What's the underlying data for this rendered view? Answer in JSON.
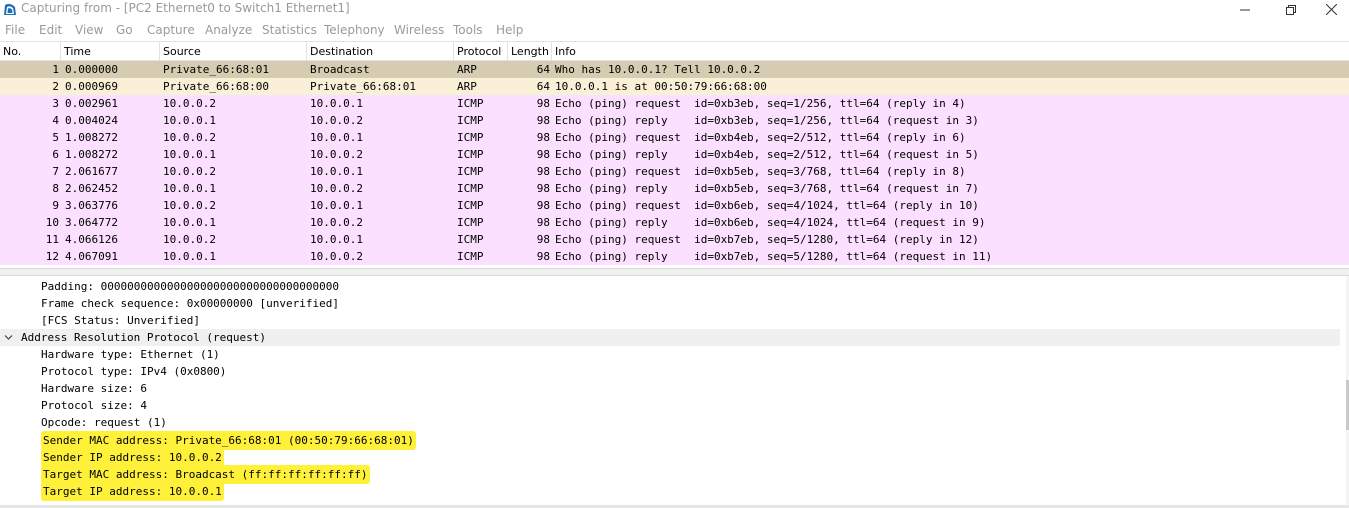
{
  "window": {
    "title": "Capturing from - [PC2 Ethernet0 to Switch1 Ethernet1]",
    "app_icon": "wireshark-fin-icon",
    "controls": [
      "minimize-icon",
      "restore-icon",
      "close-icon"
    ]
  },
  "menu": [
    "File",
    "Edit",
    "View",
    "Go",
    "Capture",
    "Analyze",
    "Statistics",
    "Telephony",
    "Wireless",
    "Tools",
    "Help"
  ],
  "packet_list": {
    "columns": [
      "No.",
      "Time",
      "Source",
      "Destination",
      "Protocol",
      "Length",
      "Info"
    ],
    "rows": [
      {
        "no": "1",
        "time": "0.000000",
        "source": "Private_66:68:01",
        "destination": "Broadcast",
        "protocol": "ARP",
        "length": "64",
        "info": "Who has 10.0.0.1? Tell 10.0.0.2",
        "color": "#d6ccb1"
      },
      {
        "no": "2",
        "time": "0.000969",
        "source": "Private_66:68:00",
        "destination": "Private_66:68:01",
        "protocol": "ARP",
        "length": "64",
        "info": "10.0.0.1 is at 00:50:79:66:68:00",
        "color": "#faf0d7"
      },
      {
        "no": "3",
        "time": "0.002961",
        "source": "10.0.0.2",
        "destination": "10.0.0.1",
        "protocol": "ICMP",
        "length": "98",
        "info": "Echo (ping) request  id=0xb3eb, seq=1/256, ttl=64 (reply in 4)",
        "color": "#fce0ff"
      },
      {
        "no": "4",
        "time": "0.004024",
        "source": "10.0.0.1",
        "destination": "10.0.0.2",
        "protocol": "ICMP",
        "length": "98",
        "info": "Echo (ping) reply    id=0xb3eb, seq=1/256, ttl=64 (request in 3)",
        "color": "#fce0ff"
      },
      {
        "no": "5",
        "time": "1.008272",
        "source": "10.0.0.2",
        "destination": "10.0.0.1",
        "protocol": "ICMP",
        "length": "98",
        "info": "Echo (ping) request  id=0xb4eb, seq=2/512, ttl=64 (reply in 6)",
        "color": "#fce0ff"
      },
      {
        "no": "6",
        "time": "1.008272",
        "source": "10.0.0.1",
        "destination": "10.0.0.2",
        "protocol": "ICMP",
        "length": "98",
        "info": "Echo (ping) reply    id=0xb4eb, seq=2/512, ttl=64 (request in 5)",
        "color": "#fce0ff"
      },
      {
        "no": "7",
        "time": "2.061677",
        "source": "10.0.0.2",
        "destination": "10.0.0.1",
        "protocol": "ICMP",
        "length": "98",
        "info": "Echo (ping) request  id=0xb5eb, seq=3/768, ttl=64 (reply in 8)",
        "color": "#fce0ff"
      },
      {
        "no": "8",
        "time": "2.062452",
        "source": "10.0.0.1",
        "destination": "10.0.0.2",
        "protocol": "ICMP",
        "length": "98",
        "info": "Echo (ping) reply    id=0xb5eb, seq=3/768, ttl=64 (request in 7)",
        "color": "#fce0ff"
      },
      {
        "no": "9",
        "time": "3.063776",
        "source": "10.0.0.2",
        "destination": "10.0.0.1",
        "protocol": "ICMP",
        "length": "98",
        "info": "Echo (ping) request  id=0xb6eb, seq=4/1024, ttl=64 (reply in 10)",
        "color": "#fce0ff"
      },
      {
        "no": "10",
        "time": "3.064772",
        "source": "10.0.0.1",
        "destination": "10.0.0.2",
        "protocol": "ICMP",
        "length": "98",
        "info": "Echo (ping) reply    id=0xb6eb, seq=4/1024, ttl=64 (request in 9)",
        "color": "#fce0ff"
      },
      {
        "no": "11",
        "time": "4.066126",
        "source": "10.0.0.2",
        "destination": "10.0.0.1",
        "protocol": "ICMP",
        "length": "98",
        "info": "Echo (ping) request  id=0xb7eb, seq=5/1280, ttl=64 (reply in 12)",
        "color": "#fce0ff"
      },
      {
        "no": "12",
        "time": "4.067091",
        "source": "10.0.0.1",
        "destination": "10.0.0.2",
        "protocol": "ICMP",
        "length": "98",
        "info": "Echo (ping) reply    id=0xb7eb, seq=5/1280, ttl=64 (request in 11)",
        "color": "#fce0ff"
      }
    ]
  },
  "details": {
    "lines": [
      {
        "text": "Padding: 000000000000000000000000000000000000",
        "level": 1,
        "highlight": false,
        "expandable": false
      },
      {
        "text": "Frame check sequence: 0x00000000 [unverified]",
        "level": 1,
        "highlight": false,
        "expandable": false
      },
      {
        "text": "[FCS Status: Unverified]",
        "level": 1,
        "highlight": false,
        "expandable": false
      },
      {
        "text": "Address Resolution Protocol (request)",
        "level": 0,
        "highlight": false,
        "expandable": true
      },
      {
        "text": "Hardware type: Ethernet (1)",
        "level": 1,
        "highlight": false,
        "expandable": false
      },
      {
        "text": "Protocol type: IPv4 (0x0800)",
        "level": 1,
        "highlight": false,
        "expandable": false
      },
      {
        "text": "Hardware size: 6",
        "level": 1,
        "highlight": false,
        "expandable": false
      },
      {
        "text": "Protocol size: 4",
        "level": 1,
        "highlight": false,
        "expandable": false
      },
      {
        "text": "Opcode: request (1)",
        "level": 1,
        "highlight": false,
        "expandable": false
      },
      {
        "text": "Sender MAC address: Private_66:68:01 (00:50:79:66:68:01)",
        "level": 1,
        "highlight": true,
        "expandable": false
      },
      {
        "text": "Sender IP address: 10.0.0.2",
        "level": 1,
        "highlight": true,
        "expandable": false
      },
      {
        "text": "Target MAC address: Broadcast (ff:ff:ff:ff:ff:ff)",
        "level": 1,
        "highlight": true,
        "expandable": false
      },
      {
        "text": "Target IP address: 10.0.0.1",
        "level": 1,
        "highlight": true,
        "expandable": false
      }
    ],
    "highlight_color": "#fff13a"
  }
}
